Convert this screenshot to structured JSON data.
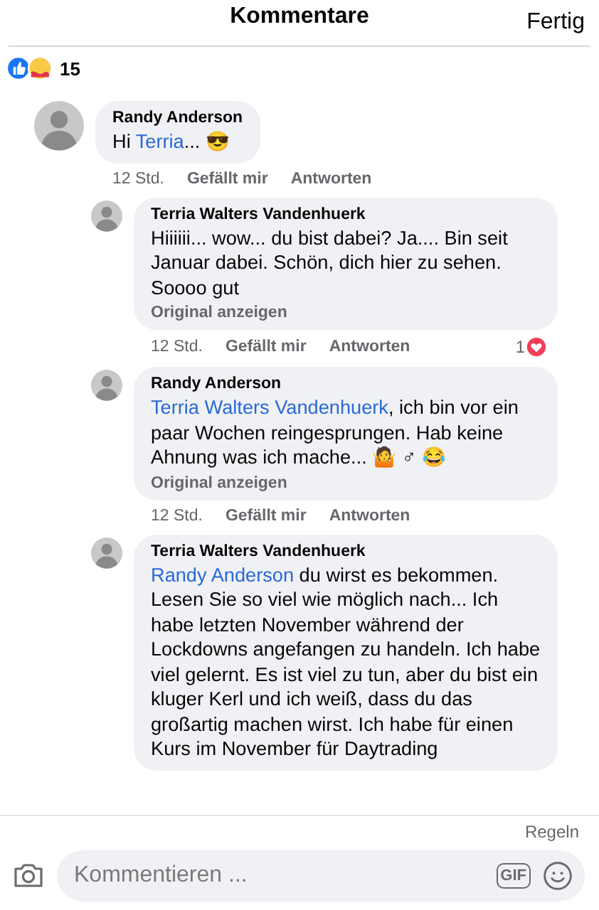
{
  "header": {
    "title": "Kommentare",
    "done": "Fertig"
  },
  "reactions": {
    "count": "15"
  },
  "comments": [
    {
      "author": "Randy Anderson",
      "lead": "Hi ",
      "mention": "Terria",
      "text": "... 😎",
      "time": "12 Std.",
      "like": "Gefällt mir",
      "reply": "Antworten",
      "children": [
        {
          "author": "Terria Walters Vandenhuerk",
          "text": "Hiiiiii... wow... du bist dabei? Ja.... Bin seit Januar dabei. Schön, dich hier zu sehen. Soooo gut",
          "original": "Original anzeigen",
          "time": "12 Std.",
          "like": "Gefällt mir",
          "reply": "Antworten",
          "reaction_count": "1"
        },
        {
          "author": "Randy Anderson",
          "mention": "Terria Walters Vandenhuerk",
          "text": ", ich bin vor ein paar Wochen reingesprungen. Hab keine Ahnung was ich mache... 🤷 ♂ 😂",
          "original": "Original anzeigen",
          "time": "12 Std.",
          "like": "Gefällt mir",
          "reply": "Antworten"
        },
        {
          "author": "Terria Walters Vandenhuerk",
          "mention": "Randy Anderson",
          "text": " du wirst es bekommen. Lesen Sie so viel wie möglich nach... Ich habe letzten November während der Lockdowns angefangen zu handeln. Ich habe viel gelernt. Es ist viel zu tun, aber du bist ein kluger Kerl und ich weiß, dass du das großartig machen wirst. Ich habe für einen Kurs im November für Daytrading"
        }
      ]
    }
  ],
  "footer": {
    "rules": "Regeln",
    "placeholder": "Kommentieren ...",
    "gif": "GIF"
  }
}
